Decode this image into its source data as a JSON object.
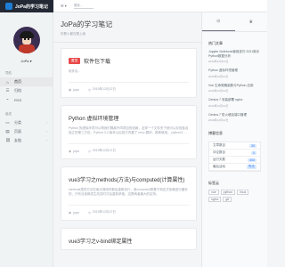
{
  "brand": {
    "name": "JoPa的学习笔记"
  },
  "topbar": {
    "menu_label": "☰ ▾",
    "search_placeholder": "搜索…"
  },
  "user": {
    "name": "JoPa ▾"
  },
  "nav": {
    "heading": "导航",
    "items": [
      {
        "icon": "home-icon",
        "glyph": "⌂",
        "label": "首页"
      },
      {
        "icon": "list-icon",
        "glyph": "☰",
        "label": "归档"
      },
      {
        "icon": "rss-icon",
        "glyph": "⌁",
        "label": "RSS"
      }
    ],
    "components_heading": "组成",
    "components": [
      {
        "icon": "folder-icon",
        "glyph": "▭",
        "label": "分类"
      },
      {
        "icon": "page-icon",
        "glyph": "▤",
        "label": "页面"
      },
      {
        "icon": "link-icon",
        "glyph": "⛓",
        "label": "友链"
      }
    ]
  },
  "page": {
    "title": "JoPa的学习笔记",
    "subtitle": "好看人都在看上面"
  },
  "posts": [
    {
      "tag": "置顶",
      "title": "软件包下载",
      "excerpt": "软件包...",
      "author": "jopa",
      "date": "2019年12月12日"
    },
    {
      "tag": "",
      "title": "Python 虚拟环境管理",
      "excerpt": "Python 的虚拟环境可以帮我们隔离不同项目的依赖，这样一个文件夹下就可以存放各自独立的第三方包，Python 3.3 版本以后官方内置了 venv 模块，推荐使用。 python3 -...",
      "author": "jopa",
      "date": "2019年12月12日"
    },
    {
      "tag": "",
      "title": "vue3学习之methods(方法)与computed(计算属性)",
      "excerpt": "methods里的方法在每次调用时都会重新执行，而computed是基于响应式依赖进行缓存的，只有当依赖发生改变时才会重新求值，这是两者最大的区别。",
      "author": "jopa",
      "date": "2019年12月12日"
    },
    {
      "tag": "",
      "title": "vue3学习之v-bind绑定属性",
      "excerpt": "",
      "author": "",
      "date": ""
    }
  ],
  "right": {
    "tab_hot": "⊙",
    "tab_new": "♛",
    "hot_heading": "热门文章",
    "hot_posts": [
      {
        "title": "Jupyter Notebook使用技巧 2021新手 Python数据分析",
        "date": "2019年12月12日"
      },
      {
        "title": "Python 虚拟环境管理",
        "date": "2019年12月12日"
      },
      {
        "title": "Vue 生命周期函数与Python 应用",
        "date": "2019年12月12日"
      },
      {
        "title": "Centos 7 安装部署 nginx",
        "date": "2019年12月12日"
      },
      {
        "title": "Centos 7 防火墙及端口管理",
        "date": "2019年12月12日"
      }
    ],
    "info_heading": "博客信息",
    "info": [
      {
        "label": "文章数目",
        "value": "30"
      },
      {
        "label": "评论数目",
        "value": "0"
      },
      {
        "label": "运行天数",
        "value": "400"
      },
      {
        "label": "最后活动",
        "value": "昨天"
      }
    ],
    "tags_heading": "标签云",
    "tags": [
      "vue",
      "python",
      "linux",
      "nginx",
      "git"
    ]
  },
  "colors": {
    "brand_bg": "#232935",
    "accent_tag": "#e84a4a",
    "link": "#3b82f6"
  }
}
